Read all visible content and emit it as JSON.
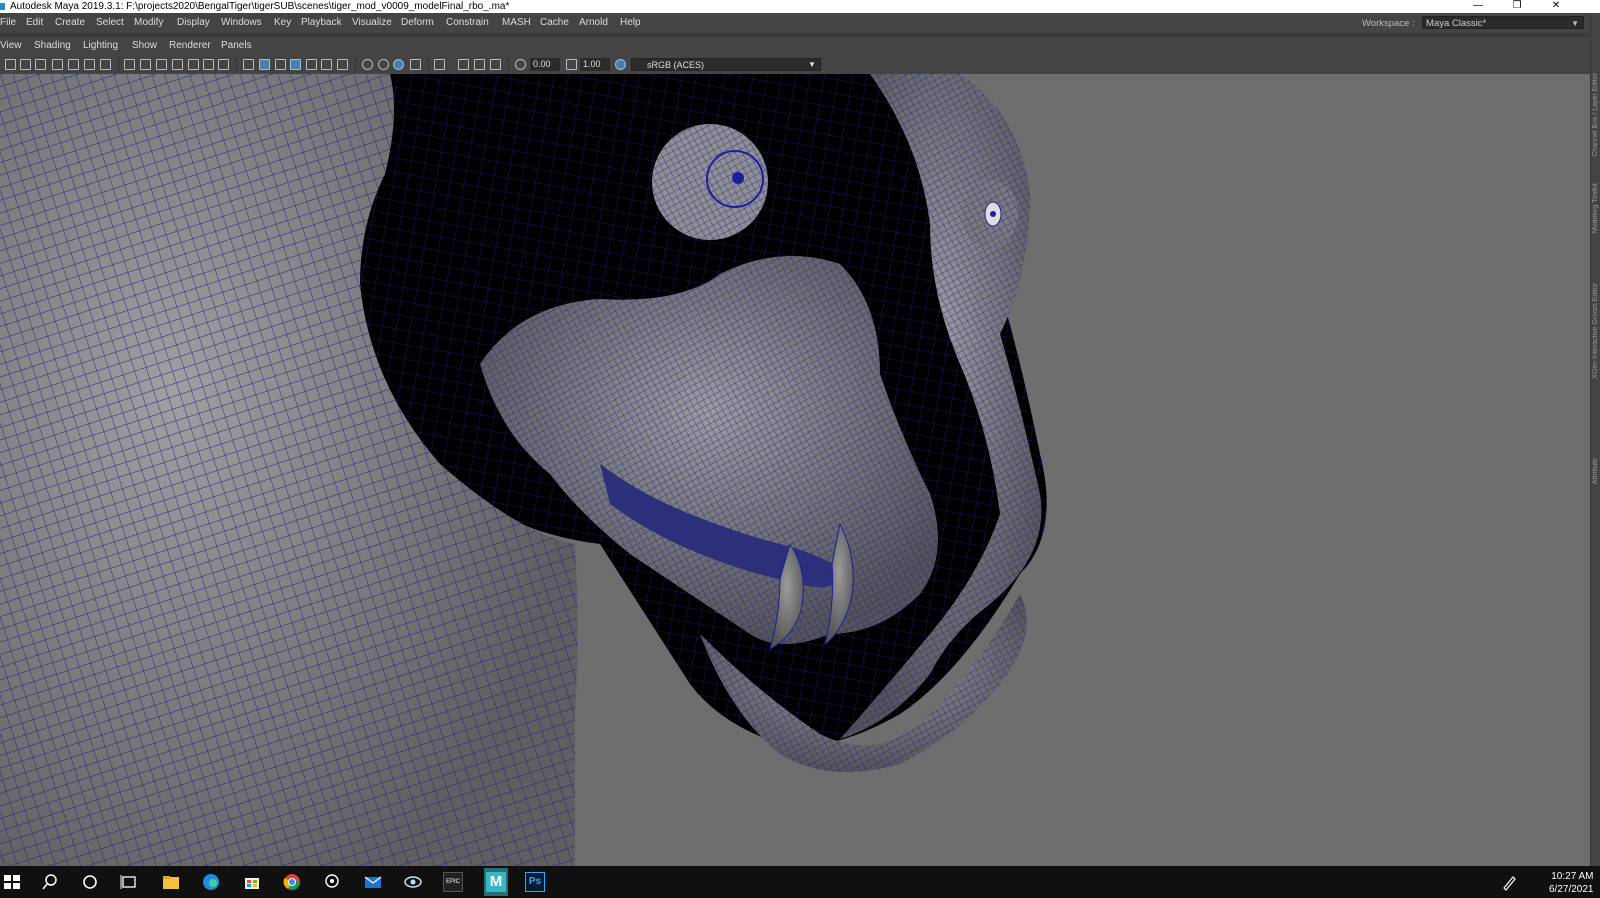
{
  "window": {
    "title": "Autodesk Maya 2019.3.1: F:\\projects2020\\BengalTiger\\tigerSUB\\scenes\\tiger_mod_v0009_modelFinal_rbo_.ma*",
    "minimize_glyph": "—",
    "restore_glyph": "❐",
    "close_glyph": "✕"
  },
  "menubar": {
    "items": [
      "File",
      "Edit",
      "Create",
      "Select",
      "Modify",
      "Display",
      "Windows",
      "Key",
      "Playback",
      "Visualize",
      "Deform",
      "Constrain",
      "MASH",
      "Cache",
      "Arnold",
      "Help"
    ],
    "workspace_label": "Workspace :",
    "workspace_value": "Maya Classic*",
    "workspace_chevron": "▼"
  },
  "panel_menu": {
    "items": [
      "View",
      "Shading",
      "Lighting",
      "Show",
      "Renderer",
      "Panels"
    ]
  },
  "toolbar": {
    "exposure": "0.00",
    "gamma": "1.00",
    "color_space": "sRGB (ACES)",
    "color_space_chevron": "▼"
  },
  "viewport": {
    "background_color": "#6e6e6e",
    "wire_color": "#1b1f9e",
    "shell_color": "#8a8a8a",
    "interior_color": "#000000"
  },
  "right_dock": {
    "tabs": [
      "Channel Box / Layer Editor",
      "Modeling Toolkit",
      "XGen Interactive Groom Editor",
      "Attribute"
    ]
  },
  "taskbar": {
    "icons": [
      "windows-start",
      "search",
      "cortana",
      "task-view",
      "file-explorer",
      "edge",
      "microsoft-store",
      "chrome",
      "feedback-hub",
      "mail",
      "unity-hub",
      "epic-games",
      "maya",
      "photoshop"
    ],
    "epic_label": "EPIC",
    "maya_label": "M",
    "ps_label": "Ps",
    "time": "10:27 AM",
    "date": "6/27/2021"
  }
}
